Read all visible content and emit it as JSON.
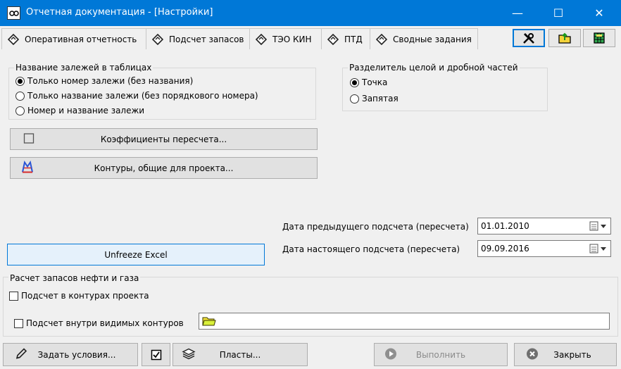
{
  "window": {
    "title": "Отчетная документация - [Настройки]",
    "minimize": "—",
    "maximize": "☐",
    "close": "✕"
  },
  "tabs": [
    {
      "label": "Оперативная отчетность"
    },
    {
      "label": "Подсчет запасов"
    },
    {
      "label": "ТЭО КИН"
    },
    {
      "label": "ПТД"
    },
    {
      "label": "Сводные задания"
    }
  ],
  "deposit_names": {
    "legend": "Название залежей в таблицах",
    "options": [
      {
        "label": "Только номер залежи (без названия)",
        "selected": true
      },
      {
        "label": "Только название залежи (без порядкового номера)",
        "selected": false
      },
      {
        "label": "Номер и название залежи",
        "selected": false
      }
    ]
  },
  "separator": {
    "legend": "Разделитель целой и дробной частей",
    "options": [
      {
        "label": "Точка",
        "selected": true
      },
      {
        "label": "Запятая",
        "selected": false
      }
    ]
  },
  "buttons": {
    "coefficients": "Коэффициенты пересчета...",
    "contours": "Контуры, общие для проекта...",
    "unfreeze": "Unfreeze Excel",
    "set_conditions": "Задать условия...",
    "layers": "Пласты...",
    "execute": "Выполнить",
    "close": "Закрыть"
  },
  "dates": {
    "previous_label": "Дата предыдущего подсчета (пересчета)",
    "previous_value": "01.01.2010",
    "current_label": "Дата настоящего подсчета (пересчета)",
    "current_value": "09.09.2016"
  },
  "reserves": {
    "legend": "Расчет запасов нефти и газа",
    "in_project_contours": "Подсчет в контурах проекта",
    "inside_visible_contours": "Подсчет внутри видимых контуров",
    "in_project_contours_checked": false,
    "inside_visible_contours_checked": false
  },
  "colors": {
    "titlebar": "#0078d7",
    "accent": "#0078d7",
    "background": "#f0f0f0"
  }
}
